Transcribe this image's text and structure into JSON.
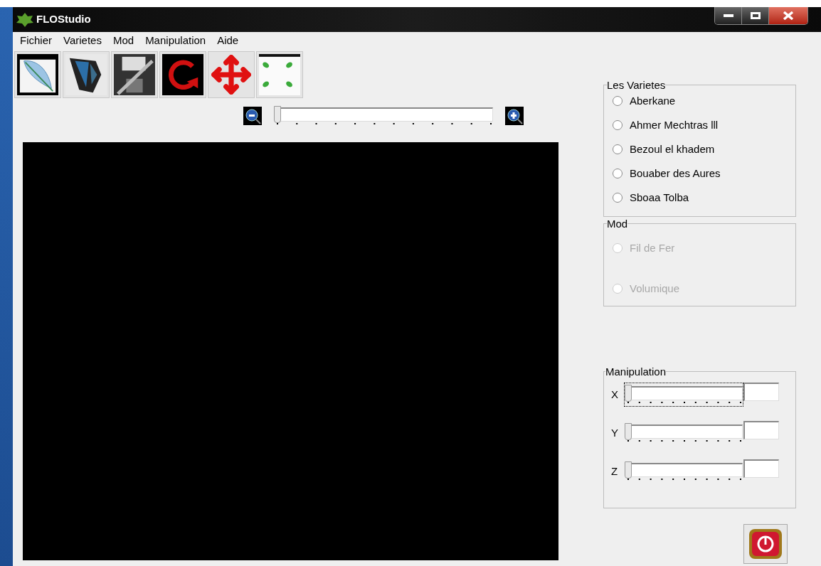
{
  "window": {
    "title": "FLOStudio"
  },
  "menu": [
    "Fichier",
    "Varietes",
    "Mod",
    "Manipulation",
    "Aide"
  ],
  "zoom": {
    "level": 0
  },
  "varietes": {
    "title": "Les Varietes",
    "options": [
      {
        "label": "Aberkane",
        "selected": false,
        "disabled": false
      },
      {
        "label": "Ahmer Mechtras lll",
        "selected": false,
        "disabled": false
      },
      {
        "label": "Bezoul el khadem",
        "selected": false,
        "disabled": false
      },
      {
        "label": "Bouaber des Aures",
        "selected": false,
        "disabled": false
      },
      {
        "label": "Sboaa Tolba",
        "selected": false,
        "disabled": false
      }
    ]
  },
  "mod": {
    "title": "Mod",
    "options": [
      {
        "label": "Fil de Fer",
        "selected": false,
        "disabled": true
      },
      {
        "label": "Volumique",
        "selected": false,
        "disabled": true
      }
    ]
  },
  "manipulation": {
    "title": "Manipulation",
    "axes": [
      {
        "label": "X",
        "level": 0,
        "focused": true
      },
      {
        "label": "Y",
        "level": 0,
        "focused": false
      },
      {
        "label": "Z",
        "level": 0,
        "focused": false
      }
    ]
  }
}
